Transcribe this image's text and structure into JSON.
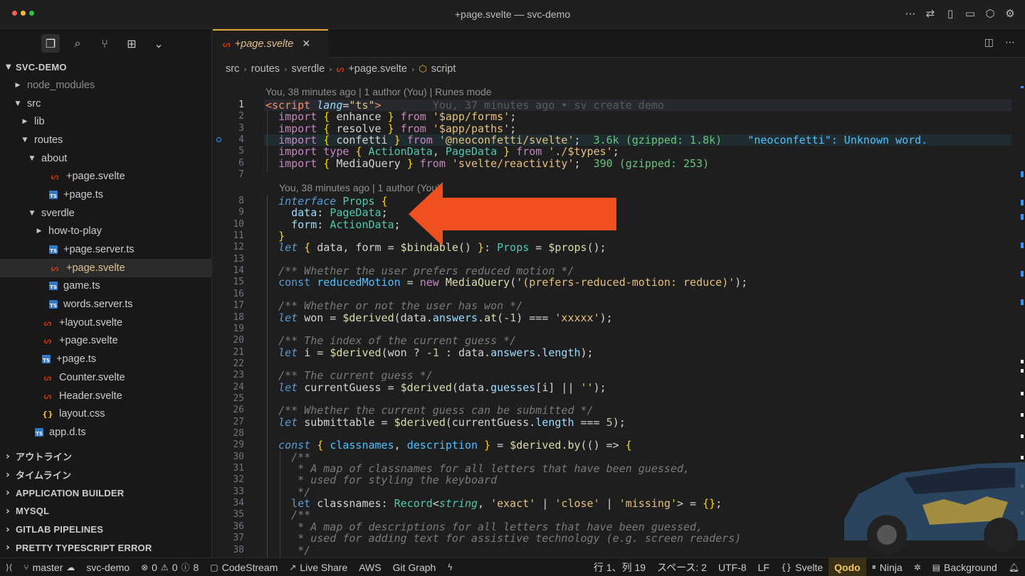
{
  "window": {
    "title": "+page.svelte — svc-demo"
  },
  "sidebar": {
    "project": "SVC-DEMO",
    "tree": [
      {
        "label": "node_modules",
        "depth": 0,
        "kind": "folder-closed",
        "dim": true
      },
      {
        "label": "src",
        "depth": 0,
        "kind": "folder-open"
      },
      {
        "label": "lib",
        "depth": 1,
        "kind": "folder-closed"
      },
      {
        "label": "routes",
        "depth": 1,
        "kind": "folder-open"
      },
      {
        "label": "about",
        "depth": 2,
        "kind": "folder-open"
      },
      {
        "label": "+page.svelte",
        "depth": 3,
        "kind": "svelte"
      },
      {
        "label": "+page.ts",
        "depth": 3,
        "kind": "ts"
      },
      {
        "label": "sverdle",
        "depth": 2,
        "kind": "folder-open"
      },
      {
        "label": "how-to-play",
        "depth": 3,
        "kind": "folder-closed"
      },
      {
        "label": "+page.server.ts",
        "depth": 3,
        "kind": "ts"
      },
      {
        "label": "+page.svelte",
        "depth": 3,
        "kind": "svelte",
        "selected": true
      },
      {
        "label": "game.ts",
        "depth": 3,
        "kind": "ts"
      },
      {
        "label": "words.server.ts",
        "depth": 3,
        "kind": "ts"
      },
      {
        "label": "+layout.svelte",
        "depth": 2,
        "kind": "svelte"
      },
      {
        "label": "+page.svelte",
        "depth": 2,
        "kind": "svelte"
      },
      {
        "label": "+page.ts",
        "depth": 2,
        "kind": "ts"
      },
      {
        "label": "Counter.svelte",
        "depth": 2,
        "kind": "svelte"
      },
      {
        "label": "Header.svelte",
        "depth": 2,
        "kind": "svelte"
      },
      {
        "label": "layout.css",
        "depth": 2,
        "kind": "css"
      },
      {
        "label": "app.d.ts",
        "depth": 1,
        "kind": "ts"
      }
    ],
    "sections": [
      "アウトライン",
      "タイムライン",
      "APPLICATION BUILDER",
      "MYSQL",
      "GITLAB PIPELINES",
      "PRETTY TYPESCRIPT ERROR"
    ]
  },
  "editor": {
    "tab_label": "+page.svelte",
    "breadcrumb": [
      "src",
      "routes",
      "sverdle",
      "+page.svelte",
      "script"
    ],
    "codelens_top": "You, 38 minutes ago | 1 author (You) | Runes mode",
    "codelens_mid": "You, 38 minutes ago | 1 author (You)",
    "inline_blame": "You, 37 minutes ago • sv create demo",
    "hint_confetti": "3.6k (gzipped: 1.8k)",
    "hint_confetti_error": "\"neoconfetti\": Unknown word.",
    "hint_mediaquery": "390 (gzipped: 253)",
    "line_numbers": [
      "1",
      "2",
      "3",
      "4",
      "5",
      "6",
      "7",
      "8",
      "9",
      "10",
      "11",
      "12",
      "13",
      "14",
      "15",
      "16",
      "17",
      "18",
      "19",
      "20",
      "21",
      "22",
      "23",
      "24",
      "25",
      "26",
      "27",
      "28",
      "29",
      "30",
      "31",
      "32",
      "33",
      "34",
      "35",
      "36",
      "37",
      "38"
    ]
  },
  "statusbar": {
    "branch": "master",
    "workspace": "svc-demo",
    "errors": "0",
    "warnings": "0",
    "info": "8",
    "codestream": "CodeStream",
    "liveshare": "Live Share",
    "aws": "AWS",
    "gitgraph": "Git Graph",
    "position": "行 1、列 19",
    "spaces": "スペース: 2",
    "encoding": "UTF-8",
    "eol": "LF",
    "language": "Svelte",
    "qodo": "Qodo",
    "ninja": "Ninja",
    "background": "Background"
  },
  "colors": {
    "accent_tab": "#e9a83a",
    "arrow": "#f0501e",
    "svelte": "#ff3e00",
    "ts": "#3178c6"
  }
}
